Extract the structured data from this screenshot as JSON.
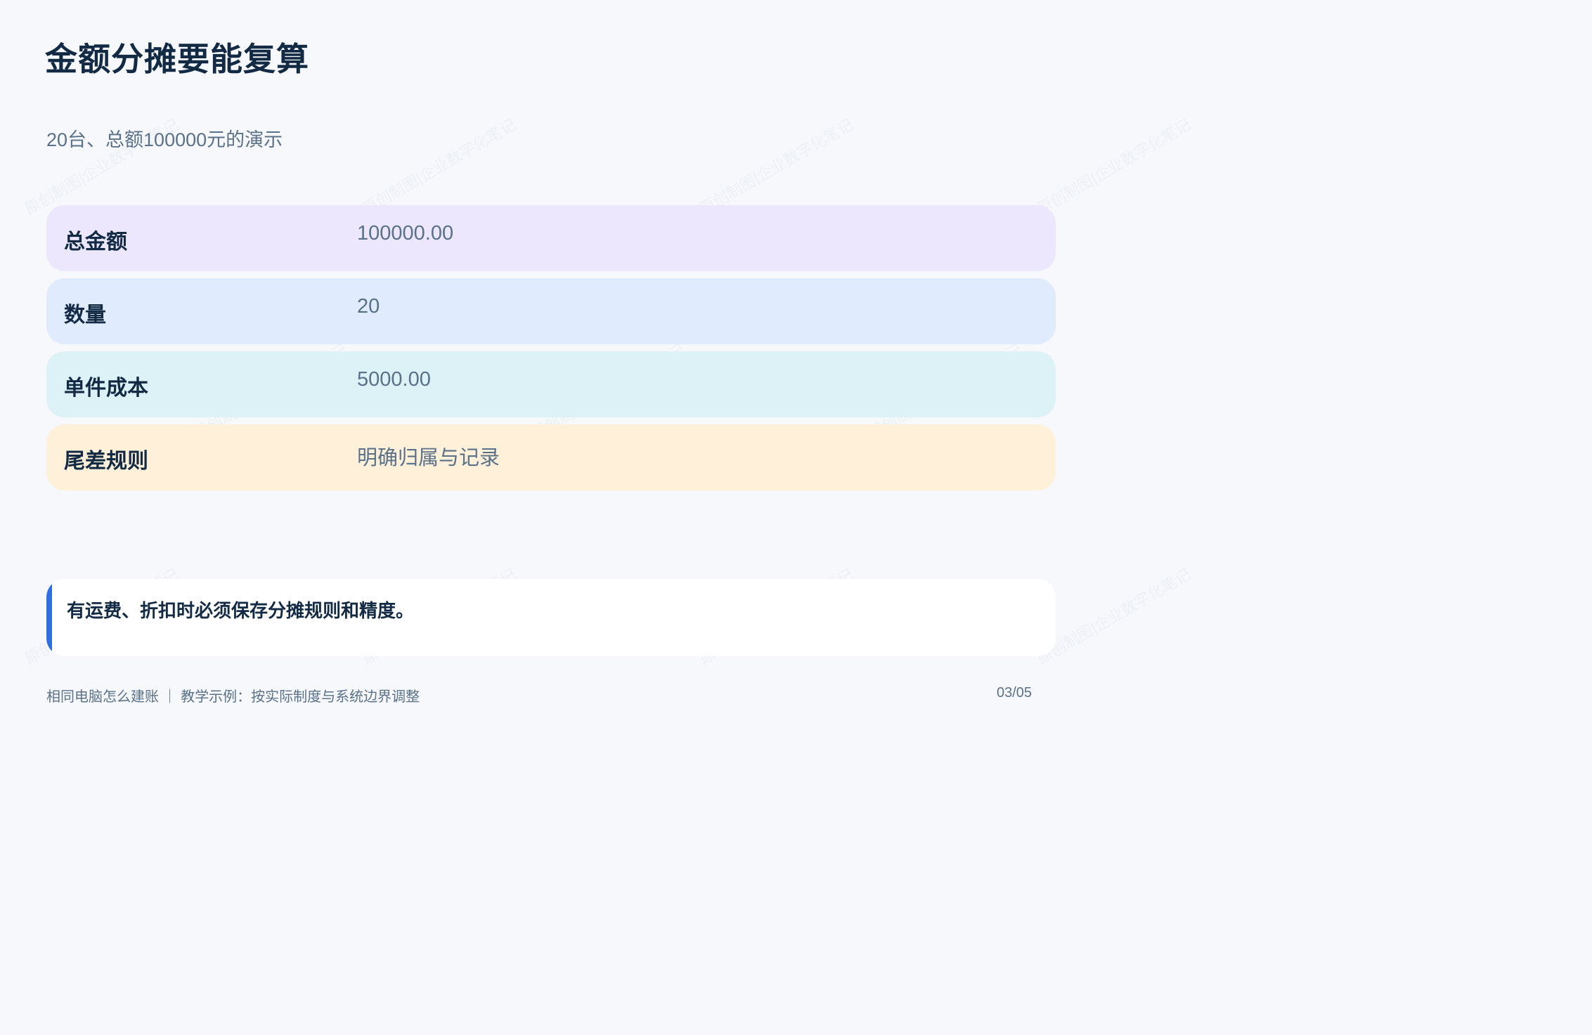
{
  "title": "金额分摊要能复算",
  "subtitle": "20台、总额100000元的演示",
  "rows": [
    {
      "label": "总金额",
      "value": "100000.00",
      "color": "#ece7fd"
    },
    {
      "label": "数量",
      "value": "20",
      "color": "#e0ebfd"
    },
    {
      "label": "单件成本",
      "value": "5000.00",
      "color": "#dcf2f7"
    },
    {
      "label": "尾差规则",
      "value": "明确归属与记录",
      "color": "#fff0d9"
    }
  ],
  "note": {
    "text": "有运费、折扣时必须保存分摊规则和精度。",
    "accent_color": "#2f6fe0"
  },
  "footer": {
    "left": "相同电脑怎么建账 ｜ 教学示例：按实际制度与系统边界调整",
    "page": "03/05"
  },
  "watermark": "原创制图|企业数字化笔记"
}
